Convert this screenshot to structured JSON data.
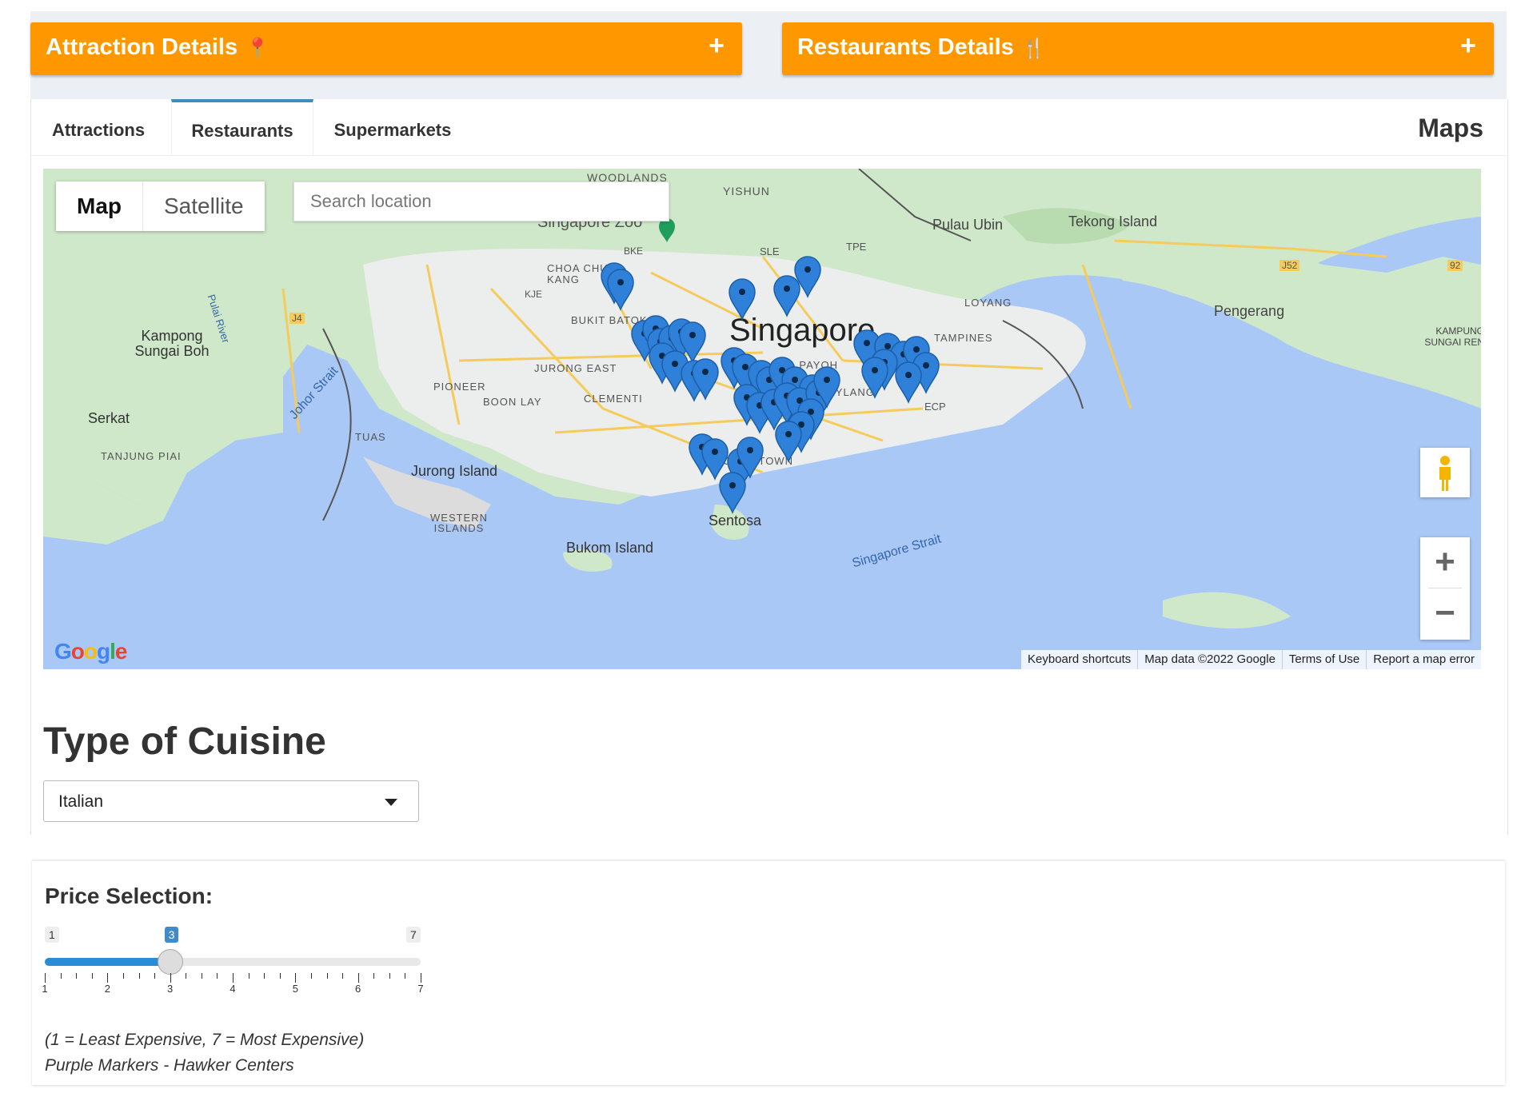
{
  "header_boxes": [
    {
      "title": "Attraction Details",
      "icon": "pin-icon",
      "icon_glyph": "📍",
      "toggle": "+"
    },
    {
      "title": "Restaurants Details",
      "icon": "fork-knife-icon",
      "icon_glyph": "🍴",
      "toggle": "+"
    }
  ],
  "header_color": "#ff9800",
  "tabs": [
    {
      "label": "Attractions",
      "active": false
    },
    {
      "label": "Restaurants",
      "active": true
    },
    {
      "label": "Supermarkets",
      "active": false
    }
  ],
  "tabs_title": "Maps",
  "map": {
    "type_buttons": [
      "Map",
      "Satellite"
    ],
    "selected_type": "Map",
    "search_placeholder": "Search location",
    "city_label": "Singapore",
    "places": [
      "WOODLANDS",
      "YISHUN",
      "Singapore Zoo",
      "Pulau Ubin",
      "Tekong Island",
      "SLE",
      "TPE",
      "CHOA CHU KANG",
      "BKE",
      "KJE",
      "J4",
      "J52",
      "92",
      "Pengerang",
      "KAMPUNG SUNGAI REN",
      "LOYANG",
      "TAMPINES",
      "Kampong Sungai Boh",
      "Pulai River",
      "BUKIT BATOK",
      "JURONG EAST",
      "TOA PAYOH",
      "PIONEER",
      "BOON LAY",
      "CLEMENTI",
      "GEYLANG",
      "ECP",
      "Johor Strait",
      "Serkat",
      "TUAS",
      "TANJUNG PIAI",
      "Jurong Island",
      "CHINATOWN",
      "Sentosa",
      "WESTERN ISLANDS",
      "Bukom Island",
      "Singapore Strait"
    ],
    "footer": [
      "Keyboard shortcuts",
      "Map data ©2022 Google",
      "Terms of Use",
      "Report a map error"
    ],
    "logo": "Google",
    "zoom_in": "+",
    "zoom_out": "−",
    "marker_color": "#2f80d8"
  },
  "cuisine": {
    "heading": "Type of Cuisine",
    "selected": "Italian"
  },
  "price": {
    "heading": "Price Selection:",
    "min": 1,
    "max": 7,
    "value": 3,
    "min_label": "1",
    "max_label": "7",
    "value_label": "3",
    "ticks": [
      "1",
      "2",
      "3",
      "4",
      "5",
      "6",
      "7"
    ],
    "note_scale": "(1 = Least Expensive, 7 = Most Expensive)",
    "note_markers": "Purple Markers - Hawker Centers",
    "accent": "#2a8bd6"
  }
}
